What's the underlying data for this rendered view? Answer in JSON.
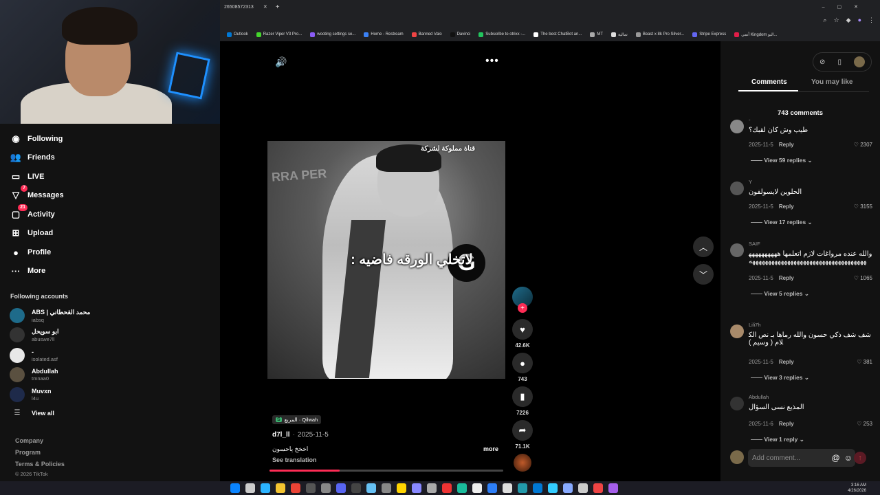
{
  "browser": {
    "tab_title": "26508572313",
    "bookmarks": [
      "Outlook",
      "Razer Viper V3 Pro...",
      "wooting settings se...",
      "Home - Restream",
      "Banned Valo",
      "Davinci",
      "Subscribe to otrixx -...",
      "The best ChatBot an...",
      "MT",
      "تمالية",
      "Beast x 8k Pro Silver...",
      "Stripe Express",
      "أنمي Kingdom البو..."
    ]
  },
  "sidebar": {
    "nav": [
      {
        "label": "Following",
        "icon": "following-icon"
      },
      {
        "label": "Friends",
        "icon": "friends-icon"
      },
      {
        "label": "LIVE",
        "icon": "live-icon"
      },
      {
        "label": "Messages",
        "icon": "messages-icon",
        "badge": "7"
      },
      {
        "label": "Activity",
        "icon": "activity-icon",
        "badge": "21"
      },
      {
        "label": "Upload",
        "icon": "upload-icon"
      },
      {
        "label": "Profile",
        "icon": "profile-icon"
      },
      {
        "label": "More",
        "icon": "more-icon"
      }
    ],
    "following_heading": "Following accounts",
    "accounts": [
      {
        "name": "ABS | محمد القحطاني",
        "handle": "iabsq"
      },
      {
        "name": "ابو سويحل",
        "handle": "abuswe7ll"
      },
      {
        "name": "-",
        "handle": "isolated.asf"
      },
      {
        "name": "Abdullah",
        "handle": "tmnaa0"
      },
      {
        "name": "Muvxn",
        "handle": "l4u"
      }
    ],
    "view_all": "View all",
    "footer": [
      "Company",
      "Program",
      "Terms & Policies"
    ],
    "copyright": "© 2026 TikTok"
  },
  "video": {
    "channel_overlay": "قناة مملوكة لشركة",
    "brand_overlay": "RRA PER",
    "caption_overlay": "لاتخلي الورقه فاضيه :",
    "mic_logo": "G",
    "sound_tag": "المربع · Qilwah",
    "author": "d7l_ll",
    "date": "2025-11-5",
    "description": "اخخخ ياحسون",
    "more": "more",
    "see_translation": "See translation",
    "progress": 0.3
  },
  "actions": {
    "likes": "42.6K",
    "comments": "743",
    "saves": "7226",
    "shares": "71.1K"
  },
  "comments_panel": {
    "tabs": [
      "Comments",
      "You may like"
    ],
    "count_label": "743 comments",
    "items": [
      {
        "name": "-",
        "text": "طيب وش كان لقبك؟",
        "date": "2025-11-5",
        "reply": "Reply",
        "likes": "2307",
        "view": "View 59 replies"
      },
      {
        "name": "Y",
        "text": "الحلوين لايسولفون",
        "date": "2025-11-5",
        "reply": "Reply",
        "likes": "3155",
        "view": "View 17 replies"
      },
      {
        "name": "SAIF",
        "text": "والله عنده مرواغات لازم اتعلمها ههههههههههههههههههههههههههههههههههههههههههههههه",
        "date": "2025-11-5",
        "reply": "Reply",
        "likes": "1065",
        "view": "View 5 replies"
      },
      {
        "name": "Lili7h",
        "text": "شف شف ذكي حسون والله رماها بـ نص الكلام ( وسيم )",
        "date": "2025-11-5",
        "reply": "Reply",
        "likes": "381",
        "view": "View 3 replies"
      },
      {
        "name": "Abdullah",
        "text": "المذيع نسى السؤال",
        "date": "2025-11-6",
        "reply": "Reply",
        "likes": "253",
        "view": "View 1 reply"
      }
    ],
    "add_placeholder": "Add comment..."
  },
  "taskbar": {
    "time": "3:16 AM",
    "date": "4/26/2026"
  },
  "colors": {
    "accent": "#fe2c55",
    "panel": "#121212"
  }
}
